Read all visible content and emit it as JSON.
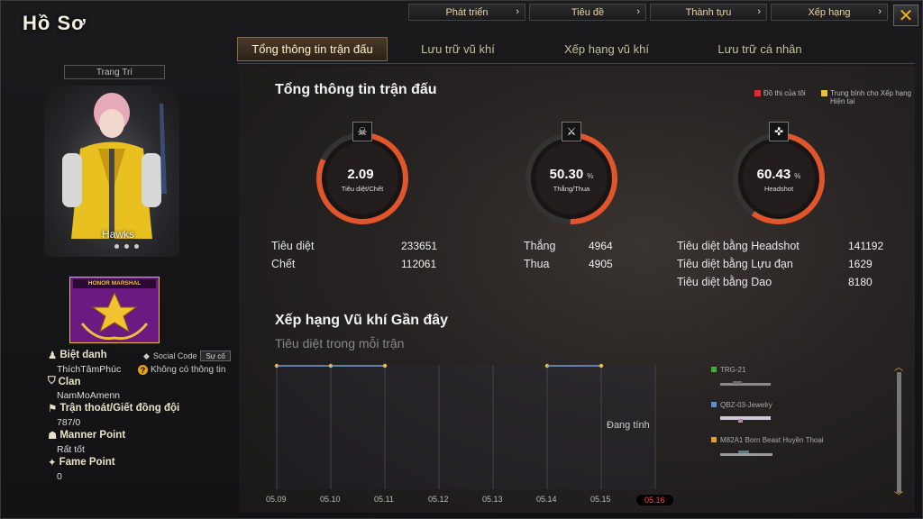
{
  "window": {
    "title": "Hồ Sơ",
    "close_icon": "close-icon"
  },
  "top_tabs": [
    {
      "label": "Phát triển"
    },
    {
      "label": "Tiêu đề"
    },
    {
      "label": "Thành tựu"
    },
    {
      "label": "Xếp hạng"
    }
  ],
  "sub_tabs": [
    {
      "label": "Tổng thông tin trận đấu",
      "active": true
    },
    {
      "label": "Lưu trữ vũ khí",
      "active": false
    },
    {
      "label": "Xếp hạng vũ khí",
      "active": false
    },
    {
      "label": "Lưu trữ cá nhân",
      "active": false
    }
  ],
  "profile": {
    "decoration_label": "Trang Trí",
    "character_name": "Hawks",
    "badge_text": "HONOR MARSHAL",
    "social_code_label": "Social Code",
    "social_code_button": "Sự cố",
    "no_info": "Không có thông tin",
    "fields": [
      {
        "label": "Biệt danh",
        "value": "ThíchTâmPhúc"
      },
      {
        "label": "Clan",
        "value": "NamMoAmenn"
      },
      {
        "label": "Trận thoát/Giết đồng đội",
        "value": "787/0"
      },
      {
        "label": "Manner Point",
        "value": "Rất tốt"
      },
      {
        "label": "Fame Point",
        "value": "0"
      }
    ]
  },
  "summary": {
    "title": "Tổng thông tin trận đấu",
    "legend_mine": "Đồ thị của tôi",
    "legend_avg": "Trung bình cho Xếp hạng Hiện tại",
    "gauges": [
      {
        "value": "2.09",
        "unit": "",
        "caption": "Tiêu diệt/Chết",
        "icon": "skull-icon",
        "fraction": 0.82
      },
      {
        "value": "50.30",
        "unit": "%",
        "caption": "Thắng/Thua",
        "icon": "crossed-swords-icon",
        "fraction": 0.503
      },
      {
        "value": "60.43",
        "unit": "%",
        "caption": "Headshot",
        "icon": "rifle-icon",
        "fraction": 0.6
      }
    ],
    "stats": {
      "kills_label": "Tiêu diệt",
      "kills": "233651",
      "deaths_label": "Chết",
      "deaths": "112061",
      "wins_label": "Thắng",
      "wins": "4964",
      "losses_label": "Thua",
      "losses": "4905",
      "headshot_label": "Tiêu diệt bằng Headshot",
      "headshot": "141192",
      "grenade_label": "Tiêu diệt bằng Lựu đạn",
      "grenade": "1629",
      "knife_label": "Tiêu diệt bằng Dao",
      "knife": "8180"
    }
  },
  "recent": {
    "title": "Xếp hạng Vũ khí Gần đây",
    "subtitle": "Tiêu diệt trong mỗi trận",
    "status": "Đang tính",
    "weapons": [
      {
        "name": "TRG-21",
        "color": "#3fae3f"
      },
      {
        "name": "QBZ-03-Jewelry",
        "color": "#5b8fd6"
      },
      {
        "name": "M82A1 Born Beast Huyền Thoại",
        "color": "#e0a030"
      }
    ]
  },
  "chart_data": {
    "type": "line",
    "categories": [
      "05.09",
      "05.10",
      "05.11",
      "05.12",
      "05.13",
      "05.14",
      "05.15",
      "05.16"
    ],
    "active_category": "05.16",
    "series": [
      {
        "values": [
          0,
          0,
          0,
          null,
          null,
          0,
          0,
          null
        ],
        "color": "#e8c040"
      }
    ]
  }
}
